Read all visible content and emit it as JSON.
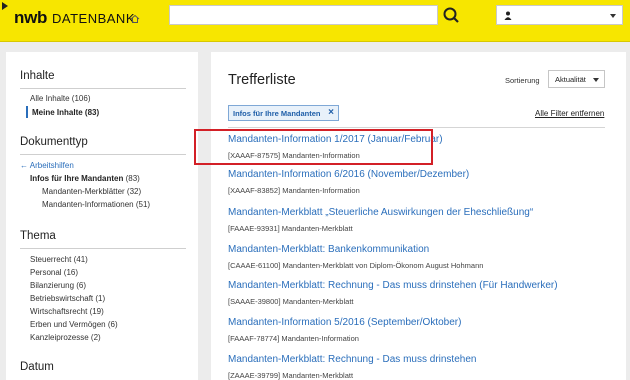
{
  "header": {
    "logo": "nwb",
    "logo_sub": "DATENBANK",
    "search": {
      "value": "",
      "placeholder": ""
    },
    "user": {
      "name": ""
    },
    "icons": [
      "home-icon",
      "search-icon",
      "user-icon",
      "chevron-down-icon"
    ],
    "colors": {
      "header_bg": "#f7e600",
      "link": "#2a6ebb",
      "highlight": "#d32027"
    }
  },
  "sidebar": {
    "inhalte": {
      "title": "Inhalte",
      "items": [
        {
          "label": "Alle Inhalte (106)"
        },
        {
          "label": "Meine Inhalte (83)"
        }
      ]
    },
    "dokumenttyp": {
      "title": "Dokumenttyp",
      "back": "← Arbeitshilfen",
      "items": [
        {
          "label": "Infos für Ihre Mandanten",
          "count": "(83)"
        },
        {
          "label": "Mandanten-Merkblätter (32)"
        },
        {
          "label": "Mandanten-Informationen (51)"
        }
      ]
    },
    "thema": {
      "title": "Thema",
      "items": [
        {
          "label": "Steuerrecht (41)"
        },
        {
          "label": "Personal (16)"
        },
        {
          "label": "Bilanzierung (6)"
        },
        {
          "label": "Betriebswirtschaft (1)"
        },
        {
          "label": "Wirtschaftsrecht (19)"
        },
        {
          "label": "Erben und Vermögen (6)"
        },
        {
          "label": "Kanzleiprozesse (2)"
        }
      ]
    },
    "datum": {
      "title": "Datum"
    }
  },
  "main": {
    "title": "Trefferliste",
    "sort_label": "Sortierung",
    "sort_value": "Aktualität",
    "filter_chip": "Infos für Ihre Mandanten",
    "chip_close": "×",
    "clear_filters": "Alle Filter entfernen",
    "results": [
      {
        "title": "Mandanten-Information 1/2017 (Januar/Februar)",
        "meta": "[XAAAF-87575] Mandanten-Information"
      },
      {
        "title": "Mandanten-Information 6/2016 (November/Dezember)",
        "meta": "[XAAAF-83852] Mandanten-Information"
      },
      {
        "title": "Mandanten-Merkblatt „Steuerliche Auswirkungen der Eheschließung“",
        "meta": "[FAAAE-93931] Mandanten-Merkblatt"
      },
      {
        "title": "Mandanten-Merkblatt: Bankenkommunikation",
        "meta": "[CAAAE-61100] Mandanten-Merkblatt von Diplom-Ökonom August Hohmann"
      },
      {
        "title": "Mandanten-Merkblatt: Rechnung - Das muss drinstehen (Für Handwerker)",
        "meta": "[SAAAE-39800] Mandanten-Merkblatt"
      },
      {
        "title": "Mandanten-Information 5/2016 (September/Oktober)",
        "meta": "[FAAAF-78774] Mandanten-Information"
      },
      {
        "title": "Mandanten-Merkblatt: Rechnung - Das muss drinstehen",
        "meta": "[ZAAAE-39799] Mandanten-Merkblatt"
      }
    ]
  }
}
